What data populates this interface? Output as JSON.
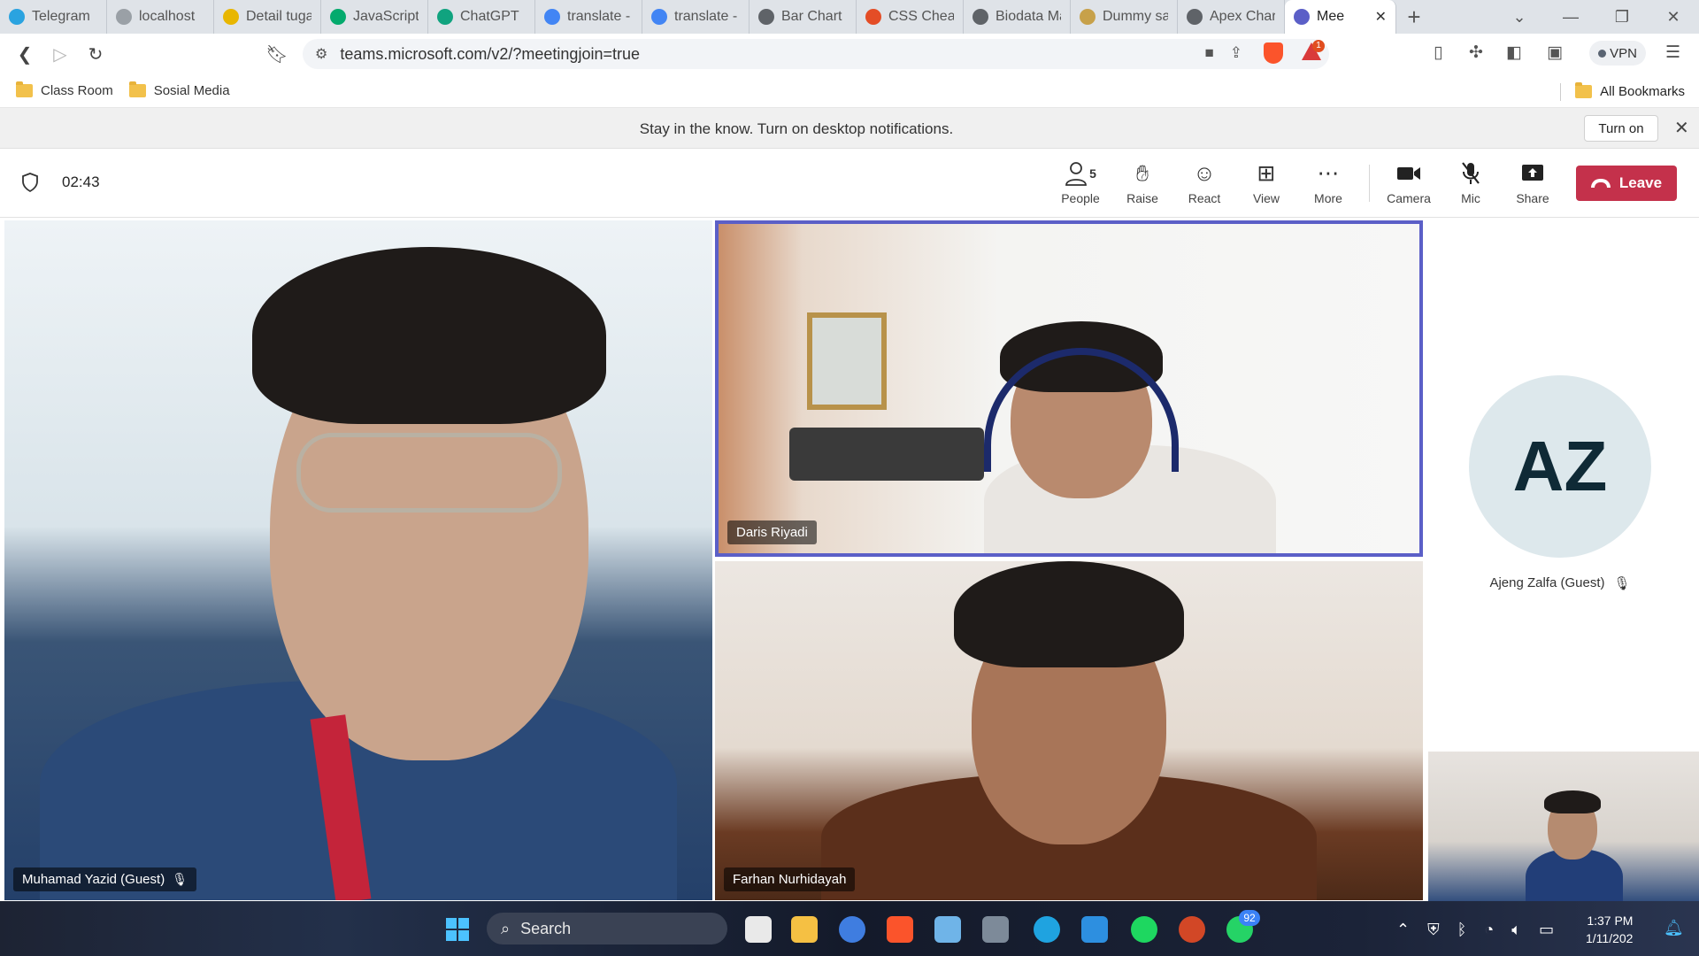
{
  "browser": {
    "tabs": [
      {
        "label": "Telegram",
        "icon": "telegram-icon",
        "color": "#2aa3e0"
      },
      {
        "label": "localhost",
        "icon": "localhost-icon",
        "color": "#9aa0a6"
      },
      {
        "label": "Detail tuga",
        "icon": "classroom-icon",
        "color": "#e8b600"
      },
      {
        "label": "JavaScript",
        "icon": "w3schools-icon",
        "color": "#04aa6d"
      },
      {
        "label": "ChatGPT",
        "icon": "chatgpt-icon",
        "color": "#10a37f"
      },
      {
        "label": "translate -",
        "icon": "google-icon",
        "color": "#4285f4"
      },
      {
        "label": "translate -",
        "icon": "google-icon",
        "color": "#4285f4"
      },
      {
        "label": "Bar Chart E",
        "icon": "globe-icon",
        "color": "#5f6368"
      },
      {
        "label": "CSS Cheat",
        "icon": "css-icon",
        "color": "#e44d26"
      },
      {
        "label": "Biodata Ma",
        "icon": "globe-icon",
        "color": "#5f6368"
      },
      {
        "label": "Dummy sa",
        "icon": "dummy-icon",
        "color": "#c7a14a"
      },
      {
        "label": "Apex Chart",
        "icon": "globe-icon",
        "color": "#5f6368"
      },
      {
        "label": "Mee",
        "icon": "teams-icon",
        "color": "#5b5fc7",
        "active": true
      }
    ],
    "url": "teams.microsoft.com/v2/?meetingjoin=true",
    "alert_count": "1",
    "vpn_label": "VPN",
    "bookmarks": [
      {
        "label": "Class Room"
      },
      {
        "label": "Sosial Media"
      }
    ],
    "all_bookmarks_label": "All Bookmarks"
  },
  "notification": {
    "text": "Stay in the know. Turn on desktop notifications.",
    "button_label": "Turn on"
  },
  "meeting": {
    "timer": "02:43",
    "people_count": "5",
    "toolbar": {
      "people": "People",
      "raise": "Raise",
      "react": "React",
      "view": "View",
      "more": "More",
      "camera": "Camera",
      "mic": "Mic",
      "share": "Share",
      "leave": "Leave"
    },
    "participants": {
      "p1": "Muhamad Yazid (Guest)",
      "p2": "Daris Riyadi",
      "p3": "Farhan Nurhidayah",
      "p4_initials": "AZ",
      "p4": "Ajeng Zalfa (Guest)"
    },
    "colors": {
      "accent": "#5b5fc7",
      "leave": "#c4314b"
    }
  },
  "taskbar": {
    "search_label": "Search",
    "whatsapp_badge": "92",
    "time": "1:37 PM",
    "date": "1/11/202"
  }
}
